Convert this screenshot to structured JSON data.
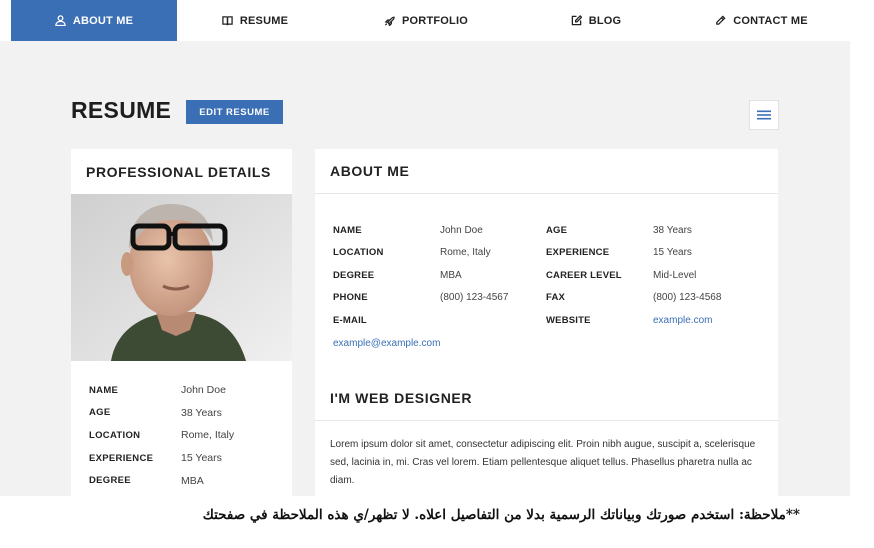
{
  "nav": {
    "items": [
      {
        "label": "ABOUT ME",
        "icon": "user-icon",
        "active": true
      },
      {
        "label": "RESUME",
        "icon": "book-icon",
        "active": false
      },
      {
        "label": "PORTFOLIO",
        "icon": "rocket-icon",
        "active": false
      },
      {
        "label": "BLOG",
        "icon": "edit-icon",
        "active": false
      },
      {
        "label": "CONTACT ME",
        "icon": "pencil-icon",
        "active": false
      }
    ]
  },
  "page": {
    "title": "RESUME",
    "edit_button": "EDIT RESUME"
  },
  "professional": {
    "heading": "PROFESSIONAL DETAILS",
    "rows": [
      {
        "key": "NAME",
        "value": "John Doe"
      },
      {
        "key": "AGE",
        "value": "38 Years"
      },
      {
        "key": "LOCATION",
        "value": "Rome, Italy"
      },
      {
        "key": "EXPERIENCE",
        "value": "15 Years"
      },
      {
        "key": "DEGREE",
        "value": "MBA"
      }
    ]
  },
  "about": {
    "heading": "ABOUT ME",
    "left": [
      {
        "key": "NAME",
        "value": "John Doe"
      },
      {
        "key": "LOCATION",
        "value": "Rome, Italy"
      },
      {
        "key": "DEGREE",
        "value": "MBA"
      },
      {
        "key": "PHONE",
        "value": "(800) 123-4567"
      },
      {
        "key": "E-MAIL",
        "value": "example@example.com"
      }
    ],
    "right": [
      {
        "key": "AGE",
        "value": "38 Years"
      },
      {
        "key": "EXPERIENCE",
        "value": "15 Years"
      },
      {
        "key": "CAREER LEVEL",
        "value": "Mid-Level"
      },
      {
        "key": "FAX",
        "value": "(800) 123-4568"
      },
      {
        "key": "WEBSITE",
        "value": "example.com"
      }
    ]
  },
  "designer": {
    "heading": "I'M WEB DESIGNER",
    "text": "Lorem ipsum dolor sit amet, consectetur adipiscing elit. Proin nibh augue, suscipit a, scelerisque sed, lacinia in, mi. Cras vel lorem. Etiam pellentesque aliquet tellus. Phasellus pharetra nulla ac diam."
  },
  "note": "**ملاحظة: استخدم صورتك وبياناتك الرسمية بدلا من التفاصيل اعلاه. لا تظهر/ي هذه الملاحظة في صفحتك",
  "colors": {
    "accent": "#3a6fb5",
    "page_bg": "#f2f2f2"
  }
}
